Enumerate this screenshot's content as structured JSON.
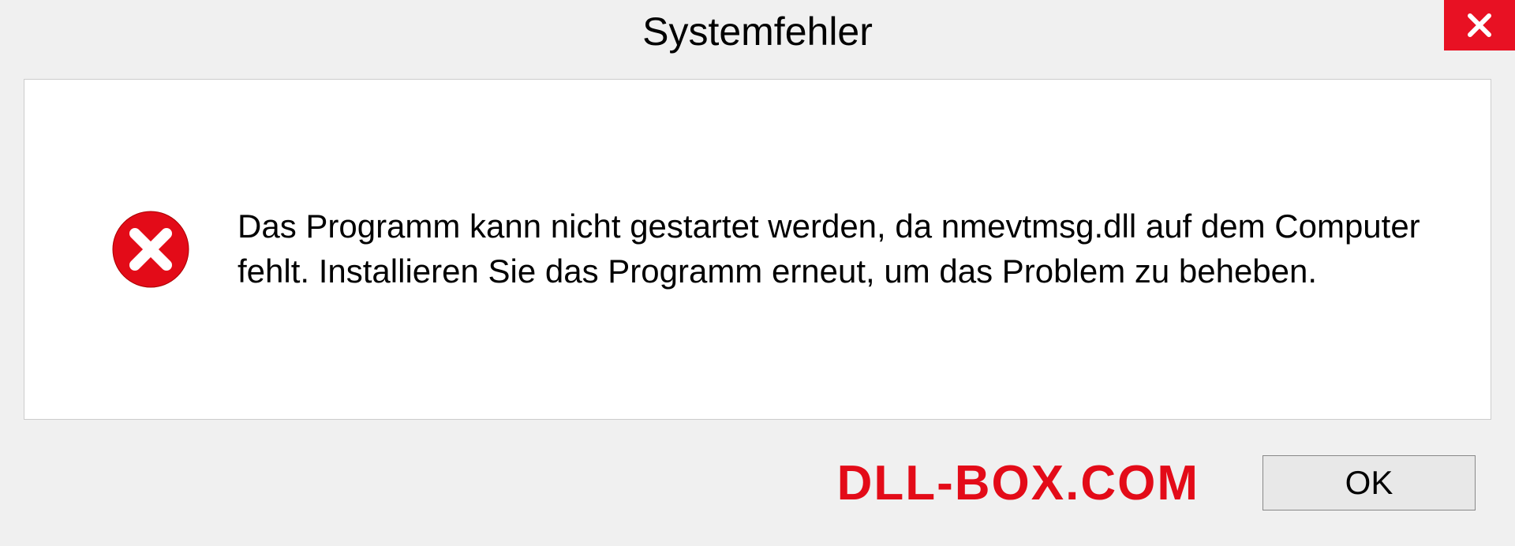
{
  "dialog": {
    "title": "Systemfehler",
    "message": "Das Programm kann nicht gestartet werden, da nmevtmsg.dll auf dem Computer fehlt. Installieren Sie das Programm erneut, um das Problem zu beheben.",
    "ok_label": "OK"
  },
  "watermark": "DLL-BOX.COM"
}
